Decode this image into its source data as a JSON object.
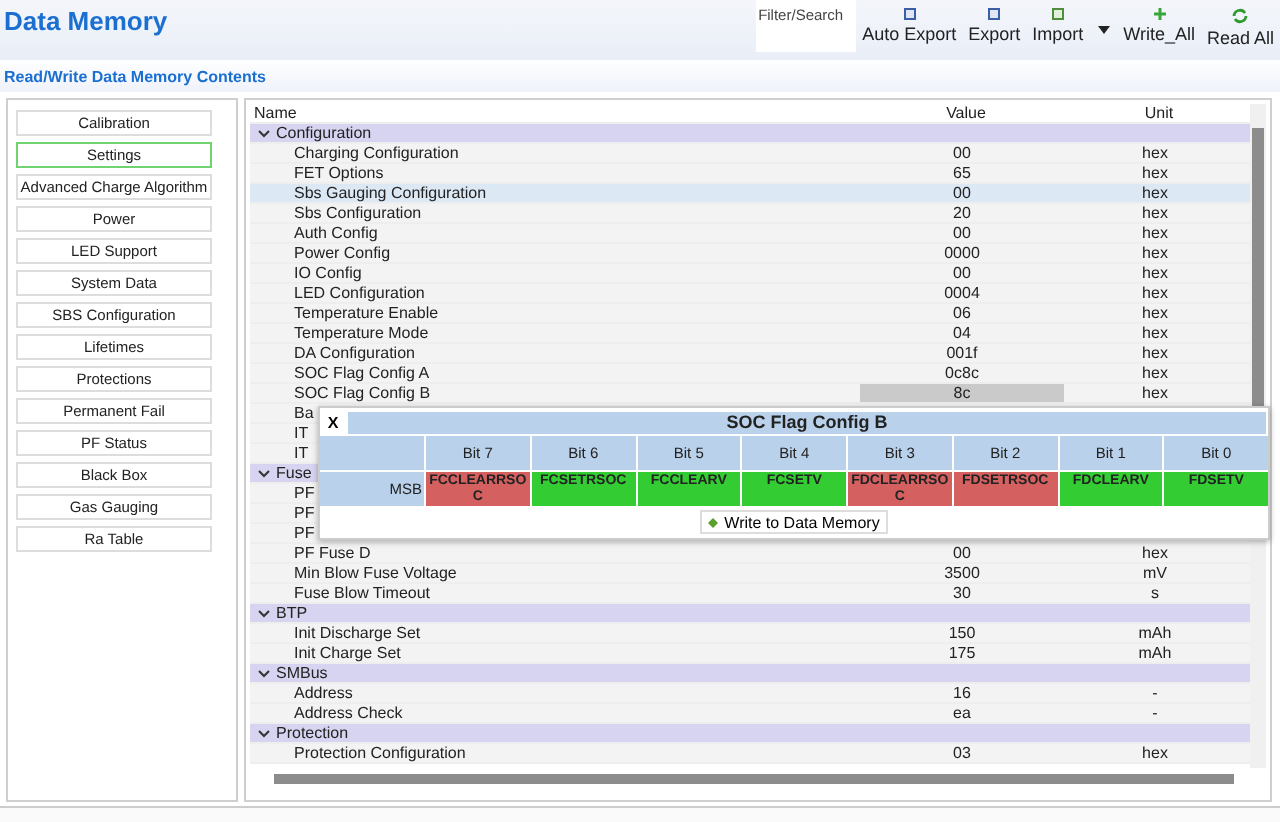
{
  "header": {
    "title": "Data Memory",
    "filter_placeholder": "Filter/Search",
    "toolbar": [
      {
        "label": "Auto Export",
        "kind": "export"
      },
      {
        "label": "Export",
        "kind": "export"
      },
      {
        "label": "Import",
        "kind": "import"
      },
      {
        "label": "Write_All",
        "kind": "write"
      },
      {
        "label": "Read All",
        "kind": "read"
      }
    ]
  },
  "subtitle": "Read/Write Data Memory Contents",
  "sidebar": {
    "items": [
      {
        "label": "Calibration",
        "selected": false
      },
      {
        "label": "Settings",
        "selected": true
      },
      {
        "label": "Advanced Charge Algorithm",
        "selected": false
      },
      {
        "label": "Power",
        "selected": false
      },
      {
        "label": "LED Support",
        "selected": false
      },
      {
        "label": "System Data",
        "selected": false
      },
      {
        "label": "SBS Configuration",
        "selected": false
      },
      {
        "label": "Lifetimes",
        "selected": false
      },
      {
        "label": "Protections",
        "selected": false
      },
      {
        "label": "Permanent Fail",
        "selected": false
      },
      {
        "label": "PF Status",
        "selected": false
      },
      {
        "label": "Black Box",
        "selected": false
      },
      {
        "label": "Gas Gauging",
        "selected": false
      },
      {
        "label": "Ra Table",
        "selected": false
      }
    ]
  },
  "table": {
    "columns": [
      "Name",
      "Value",
      "Unit"
    ],
    "groups": [
      {
        "name": "Configuration",
        "expanded": true,
        "rows": [
          {
            "name": "Charging Configuration",
            "value": "00",
            "unit": "hex",
            "selected": false,
            "value_active": false
          },
          {
            "name": "FET Options",
            "value": "65",
            "unit": "hex",
            "selected": false,
            "value_active": false
          },
          {
            "name": "Sbs Gauging Configuration",
            "value": "00",
            "unit": "hex",
            "selected": true,
            "value_active": false
          },
          {
            "name": "Sbs Configuration",
            "value": "20",
            "unit": "hex",
            "selected": false,
            "value_active": false
          },
          {
            "name": "Auth Config",
            "value": "00",
            "unit": "hex",
            "selected": false,
            "value_active": false
          },
          {
            "name": "Power Config",
            "value": "0000",
            "unit": "hex",
            "selected": false,
            "value_active": false
          },
          {
            "name": "IO Config",
            "value": "00",
            "unit": "hex",
            "selected": false,
            "value_active": false
          },
          {
            "name": "LED Configuration",
            "value": "0004",
            "unit": "hex",
            "selected": false,
            "value_active": false
          },
          {
            "name": "Temperature Enable",
            "value": "06",
            "unit": "hex",
            "selected": false,
            "value_active": false
          },
          {
            "name": "Temperature Mode",
            "value": "04",
            "unit": "hex",
            "selected": false,
            "value_active": false
          },
          {
            "name": "DA Configuration",
            "value": "001f",
            "unit": "hex",
            "selected": false,
            "value_active": false
          },
          {
            "name": "SOC Flag Config A",
            "value": "0c8c",
            "unit": "hex",
            "selected": false,
            "value_active": false
          },
          {
            "name": "SOC Flag Config B",
            "value": "8c",
            "unit": "hex",
            "selected": false,
            "value_active": true
          },
          {
            "name": "Ba",
            "selected": false,
            "value_active": false
          },
          {
            "name": "IT",
            "selected": false,
            "value_active": false
          },
          {
            "name": "IT",
            "selected": false,
            "value_active": false
          }
        ]
      },
      {
        "name": "Fuse",
        "expanded": true,
        "rows": [
          {
            "name": "PF",
            "selected": false,
            "value_active": false
          },
          {
            "name": "PF",
            "selected": false,
            "value_active": false
          },
          {
            "name": "PF",
            "selected": false,
            "value_active": false
          },
          {
            "name": "PF Fuse D",
            "value": "00",
            "unit": "hex",
            "selected": false,
            "value_active": false
          },
          {
            "name": "Min Blow Fuse Voltage",
            "value": "3500",
            "unit": "mV",
            "selected": false,
            "value_active": false
          },
          {
            "name": "Fuse Blow Timeout",
            "value": "30",
            "unit": "s",
            "selected": false,
            "value_active": false
          }
        ]
      },
      {
        "name": "BTP",
        "expanded": true,
        "rows": [
          {
            "name": "Init Discharge Set",
            "value": "150",
            "unit": "mAh",
            "selected": false,
            "value_active": false
          },
          {
            "name": "Init Charge Set",
            "value": "175",
            "unit": "mAh",
            "selected": false,
            "value_active": false
          }
        ]
      },
      {
        "name": "SMBus",
        "expanded": true,
        "rows": [
          {
            "name": "Address",
            "value": "16",
            "unit": "-",
            "selected": false,
            "value_active": false
          },
          {
            "name": "Address Check",
            "value": "ea",
            "unit": "-",
            "selected": false,
            "value_active": false
          }
        ]
      },
      {
        "name": "Protection",
        "expanded": true,
        "rows": [
          {
            "name": "Protection Configuration",
            "value": "03",
            "unit": "hex",
            "selected": false,
            "value_active": false
          }
        ]
      }
    ]
  },
  "popup": {
    "close": "X",
    "title": "SOC Flag Config B",
    "row_label": "MSB",
    "button": "Write to Data Memory",
    "bits": [
      {
        "label": "Bit 7",
        "name": "FCCLEARRSOC",
        "set": true
      },
      {
        "label": "Bit 6",
        "name": "FCSETRSOC",
        "set": false
      },
      {
        "label": "Bit 5",
        "name": "FCCLEARV",
        "set": false
      },
      {
        "label": "Bit 4",
        "name": "FCSETV",
        "set": false
      },
      {
        "label": "Bit 3",
        "name": "FDCLEARRSOC",
        "set": true
      },
      {
        "label": "Bit 2",
        "name": "FDSETRSOC",
        "set": true
      },
      {
        "label": "Bit 1",
        "name": "FDCLEARV",
        "set": false
      },
      {
        "label": "Bit 0",
        "name": "FDSETV",
        "set": false
      }
    ]
  }
}
